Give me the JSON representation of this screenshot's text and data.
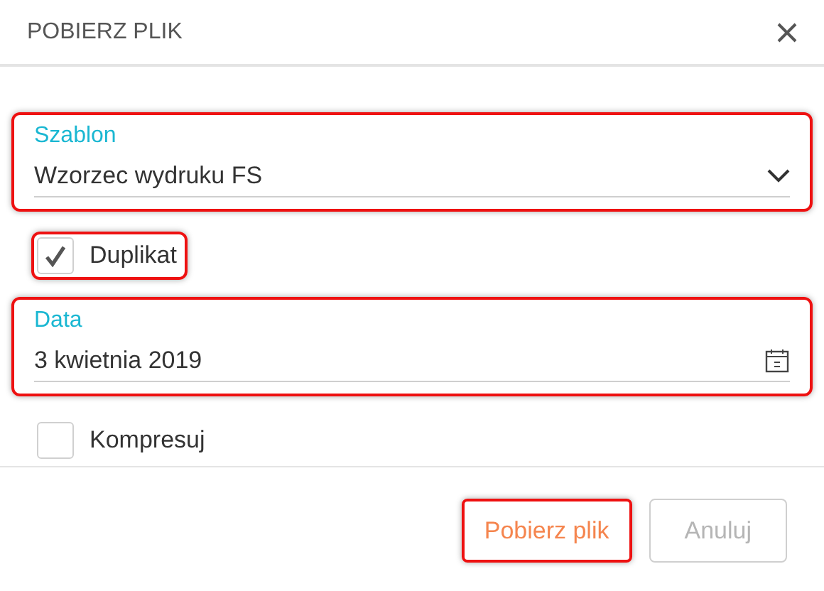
{
  "dialog": {
    "title": "POBIERZ PLIK"
  },
  "fields": [
    {
      "kind": "select",
      "label": "Szablon",
      "value": "Wzorzec wydruku FS",
      "highlighted": true
    },
    {
      "kind": "checkbox",
      "label": "Duplikat",
      "checked": true,
      "highlighted": true
    },
    {
      "kind": "date",
      "label": "Data",
      "value": "3 kwietnia 2019",
      "highlighted": true
    },
    {
      "kind": "checkbox",
      "label": "Kompresuj",
      "checked": false,
      "highlighted": false
    }
  ],
  "buttons": [
    {
      "label": "Pobierz plik",
      "kind": "primary",
      "highlighted": true
    },
    {
      "label": "Anuluj",
      "kind": "secondary",
      "highlighted": false
    }
  ]
}
